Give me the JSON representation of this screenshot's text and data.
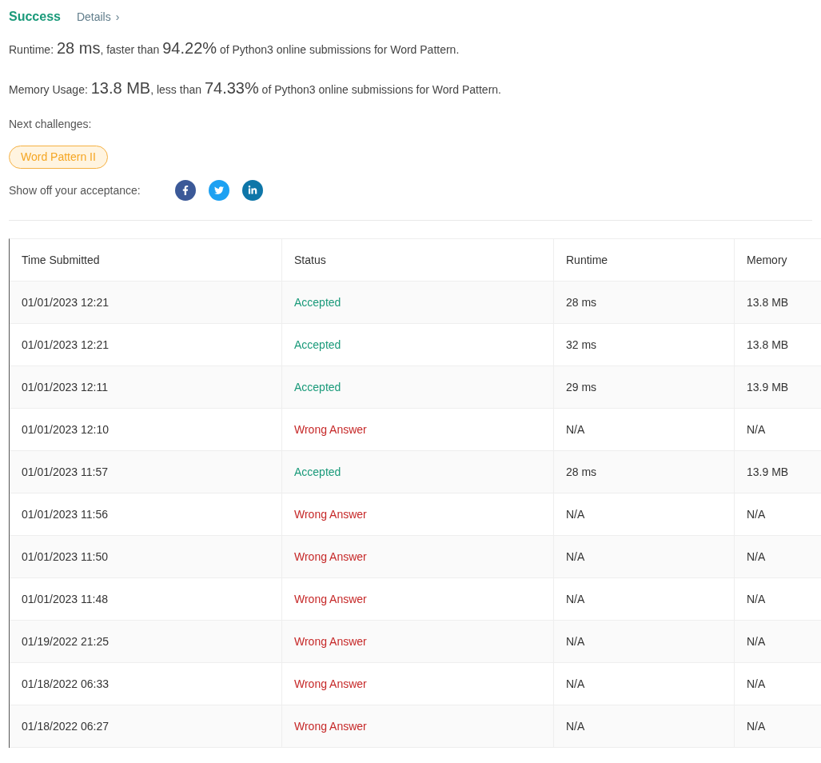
{
  "header": {
    "title": "Success",
    "details_link": "Details",
    "chevron": "›"
  },
  "stats": [
    {
      "label": "Runtime: ",
      "value": "28 ms",
      "middle": ", faster than ",
      "percent": "94.22%",
      "tail": " of Python3 online submissions for Word Pattern."
    },
    {
      "label": "Memory Usage: ",
      "value": "13.8 MB",
      "middle": ", less than ",
      "percent": "74.33%",
      "tail": " of Python3 online submissions for Word Pattern."
    }
  ],
  "next_challenges": {
    "label": "Next challenges:",
    "items": [
      "Word Pattern II"
    ]
  },
  "share": {
    "label": "Show off your acceptance:",
    "networks": [
      {
        "kind": "facebook",
        "color": "#3b5998"
      },
      {
        "kind": "twitter",
        "color": "#1da1f2"
      },
      {
        "kind": "linkedin",
        "color": "#0e76a8"
      }
    ]
  },
  "table": {
    "columns": [
      "Time Submitted",
      "Status",
      "Runtime",
      "Memory"
    ],
    "rows": [
      {
        "time": "01/01/2023 12:21",
        "status": "Accepted",
        "kind": "accepted",
        "runtime": "28 ms",
        "memory": "13.8 MB"
      },
      {
        "time": "01/01/2023 12:21",
        "status": "Accepted",
        "kind": "accepted",
        "runtime": "32 ms",
        "memory": "13.8 MB"
      },
      {
        "time": "01/01/2023 12:11",
        "status": "Accepted",
        "kind": "accepted",
        "runtime": "29 ms",
        "memory": "13.9 MB"
      },
      {
        "time": "01/01/2023 12:10",
        "status": "Wrong Answer",
        "kind": "wrong",
        "runtime": "N/A",
        "memory": "N/A"
      },
      {
        "time": "01/01/2023 11:57",
        "status": "Accepted",
        "kind": "accepted",
        "runtime": "28 ms",
        "memory": "13.9 MB"
      },
      {
        "time": "01/01/2023 11:56",
        "status": "Wrong Answer",
        "kind": "wrong",
        "runtime": "N/A",
        "memory": "N/A"
      },
      {
        "time": "01/01/2023 11:50",
        "status": "Wrong Answer",
        "kind": "wrong",
        "runtime": "N/A",
        "memory": "N/A"
      },
      {
        "time": "01/01/2023 11:48",
        "status": "Wrong Answer",
        "kind": "wrong",
        "runtime": "N/A",
        "memory": "N/A"
      },
      {
        "time": "01/19/2022 21:25",
        "status": "Wrong Answer",
        "kind": "wrong",
        "runtime": "N/A",
        "memory": "N/A"
      },
      {
        "time": "01/18/2022 06:33",
        "status": "Wrong Answer",
        "kind": "wrong",
        "runtime": "N/A",
        "memory": "N/A"
      },
      {
        "time": "01/18/2022 06:27",
        "status": "Wrong Answer",
        "kind": "wrong",
        "runtime": "N/A",
        "memory": "N/A"
      }
    ]
  }
}
